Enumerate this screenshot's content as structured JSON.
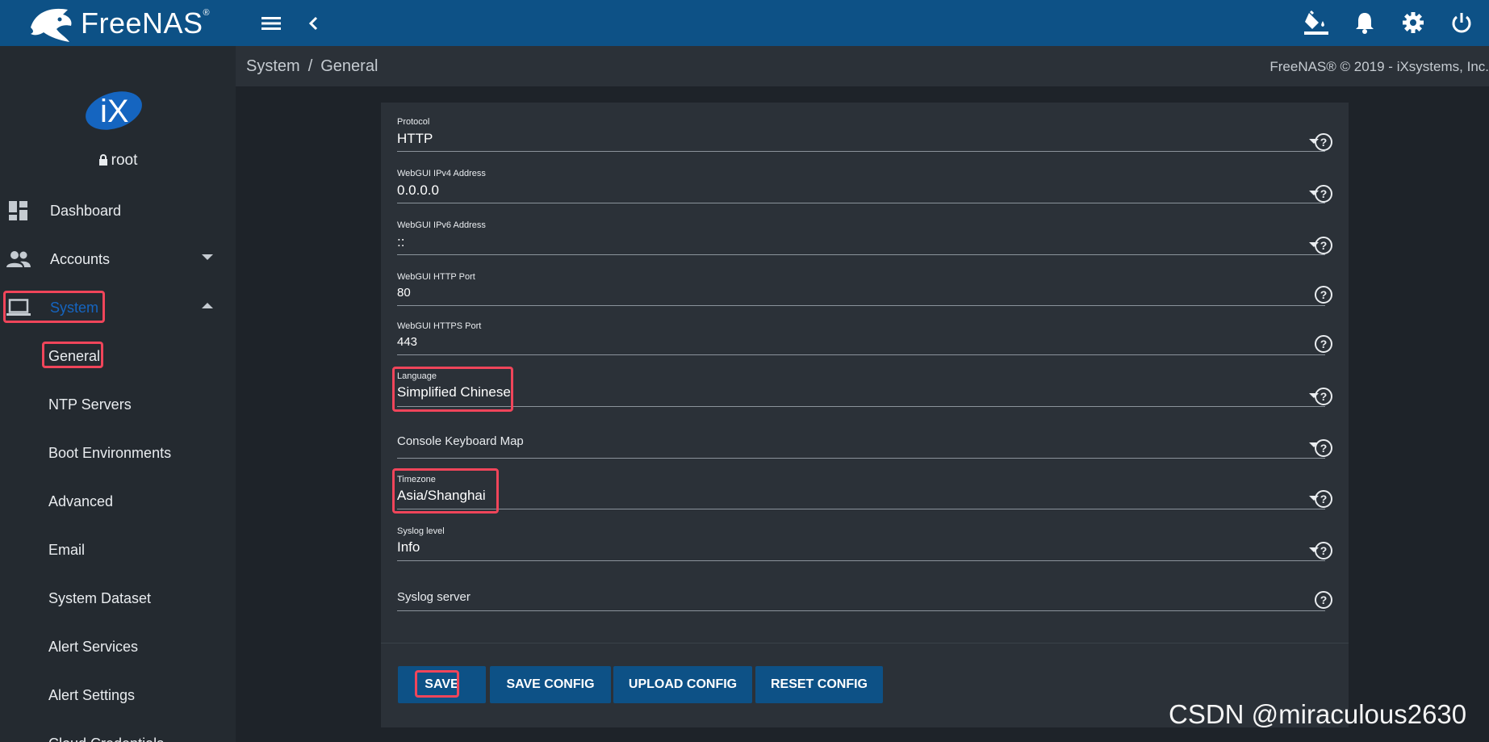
{
  "topbar": {
    "brand": "FreeNAS",
    "brand_mark": "®"
  },
  "sidebar": {
    "logo_text": "iX",
    "user": "root",
    "nav": [
      {
        "label": "Dashboard"
      },
      {
        "label": "Accounts"
      },
      {
        "label": "System"
      }
    ],
    "system_sub": [
      {
        "label": "General"
      },
      {
        "label": "NTP Servers"
      },
      {
        "label": "Boot Environments"
      },
      {
        "label": "Advanced"
      },
      {
        "label": "Email"
      },
      {
        "label": "System Dataset"
      },
      {
        "label": "Alert Services"
      },
      {
        "label": "Alert Settings"
      },
      {
        "label": "Cloud Credentials"
      }
    ]
  },
  "breadcrumb": {
    "root": "System",
    "separator": "/",
    "current": "General",
    "copyright": "FreeNAS® © 2019 - iXsystems, Inc."
  },
  "form": {
    "protocol": {
      "label": "Protocol",
      "value": "HTTP"
    },
    "ipv4": {
      "label": "WebGUI IPv4 Address",
      "value": "0.0.0.0"
    },
    "ipv6": {
      "label": "WebGUI IPv6 Address",
      "value": "::"
    },
    "http_port": {
      "label": "WebGUI HTTP Port",
      "value": "80"
    },
    "https_port": {
      "label": "WebGUI HTTPS Port",
      "value": "443"
    },
    "language": {
      "label": "Language",
      "value": "Simplified Chinese"
    },
    "keyboard": {
      "placeholder": "Console Keyboard Map"
    },
    "timezone": {
      "label": "Timezone",
      "value": "Asia/Shanghai"
    },
    "syslog_level": {
      "label": "Syslog level",
      "value": "Info"
    },
    "syslog_server": {
      "placeholder": "Syslog server"
    }
  },
  "buttons": {
    "save": "SAVE",
    "save_config": "SAVE CONFIG",
    "upload_config": "UPLOAD CONFIG",
    "reset_config": "RESET CONFIG"
  },
  "watermark": "CSDN @miraculous2630",
  "colors": {
    "topbar": "#0d5186",
    "highlight": "#f0455a",
    "active_nav": "#1565c0"
  }
}
